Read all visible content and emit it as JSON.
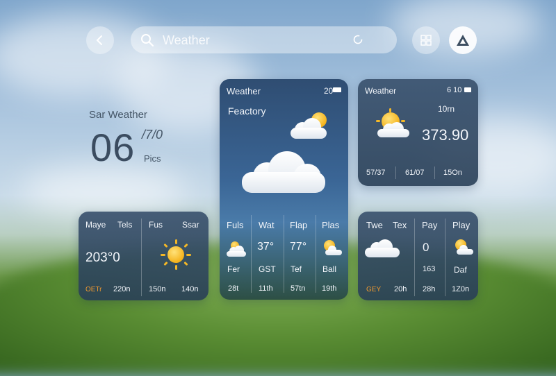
{
  "search": {
    "placeholder": "Weather"
  },
  "hero": {
    "label": "Sar Weather",
    "temp": "06",
    "sub1": "/7/0",
    "sub2": "Pics"
  },
  "card_tall": {
    "title": "Weather",
    "battery": "20",
    "location": "Feactory",
    "days": [
      "Fuls",
      "Wat",
      "Flap",
      "Plas"
    ],
    "values": [
      "",
      "37°",
      "77°",
      ""
    ],
    "labels": [
      "Fer",
      "GST",
      "Tef",
      "Ball"
    ],
    "times": [
      "28t",
      "11th",
      "57tn",
      "19th"
    ]
  },
  "card_tr": {
    "title": "Weather",
    "status": "6 10",
    "sub": "10rn",
    "temp": "373.90",
    "footer": [
      "57/37",
      "61/07",
      "15On"
    ]
  },
  "card_bl": {
    "headers": [
      "Maye",
      "Tels",
      "Fus",
      "Ssar"
    ],
    "temp": "203°0",
    "footer": [
      "OETr",
      "220n",
      "150n",
      "140n"
    ]
  },
  "card_br": {
    "headers": [
      "Twe",
      "Tex",
      "Pay",
      "Play"
    ],
    "value": "0",
    "labels": [
      "",
      "",
      "163",
      "Daf"
    ],
    "footer": [
      "GEY",
      "20h",
      "28h",
      "1Z0n"
    ]
  },
  "colors": {
    "accent_orange": "#f29a2e",
    "sun": "#f4b21b"
  }
}
